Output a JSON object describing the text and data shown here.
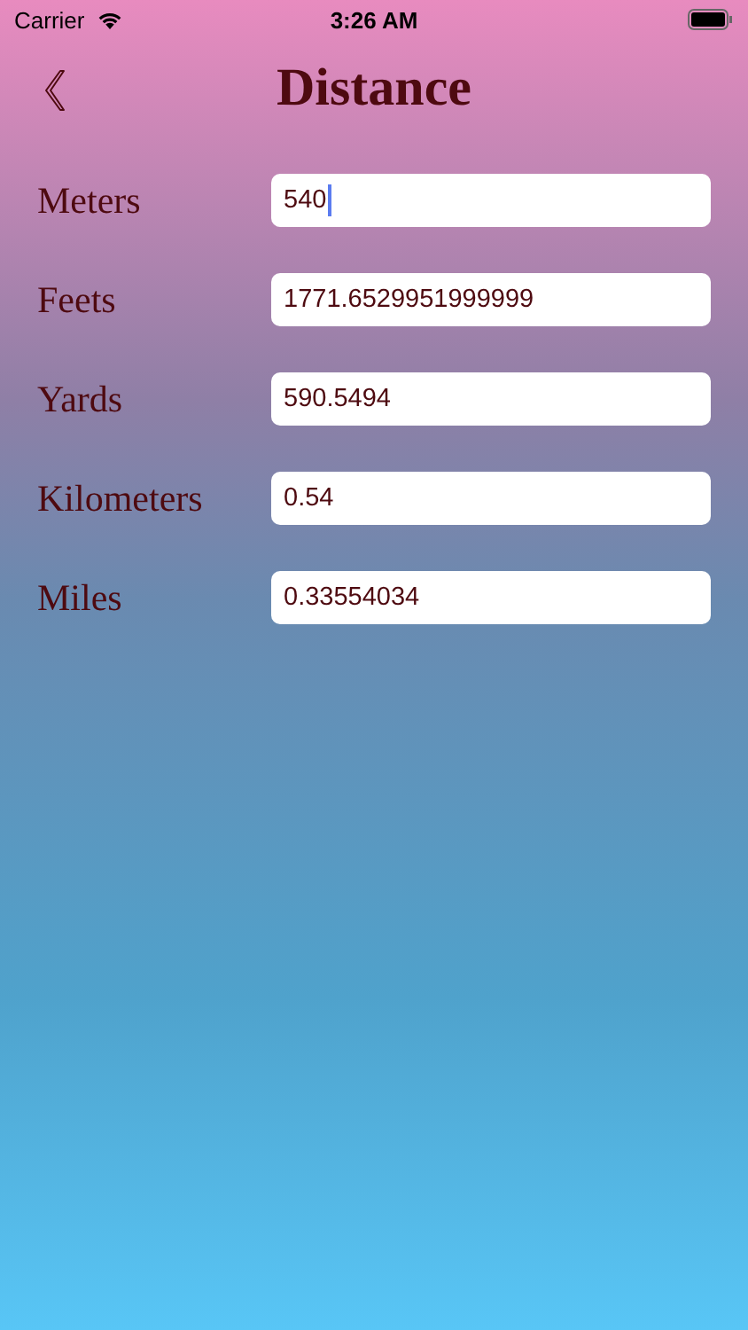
{
  "status_bar": {
    "carrier": "Carrier",
    "time": "3:26 AM"
  },
  "nav": {
    "title": "Distance"
  },
  "fields": [
    {
      "label": "Meters",
      "value": "540",
      "focused": true
    },
    {
      "label": "Feets",
      "value": "1771.6529951999999",
      "focused": false
    },
    {
      "label": "Yards",
      "value": "590.5494",
      "focused": false
    },
    {
      "label": "Kilometers",
      "value": "0.54",
      "focused": false
    },
    {
      "label": "Miles",
      "value": "0.33554034",
      "focused": false
    }
  ]
}
